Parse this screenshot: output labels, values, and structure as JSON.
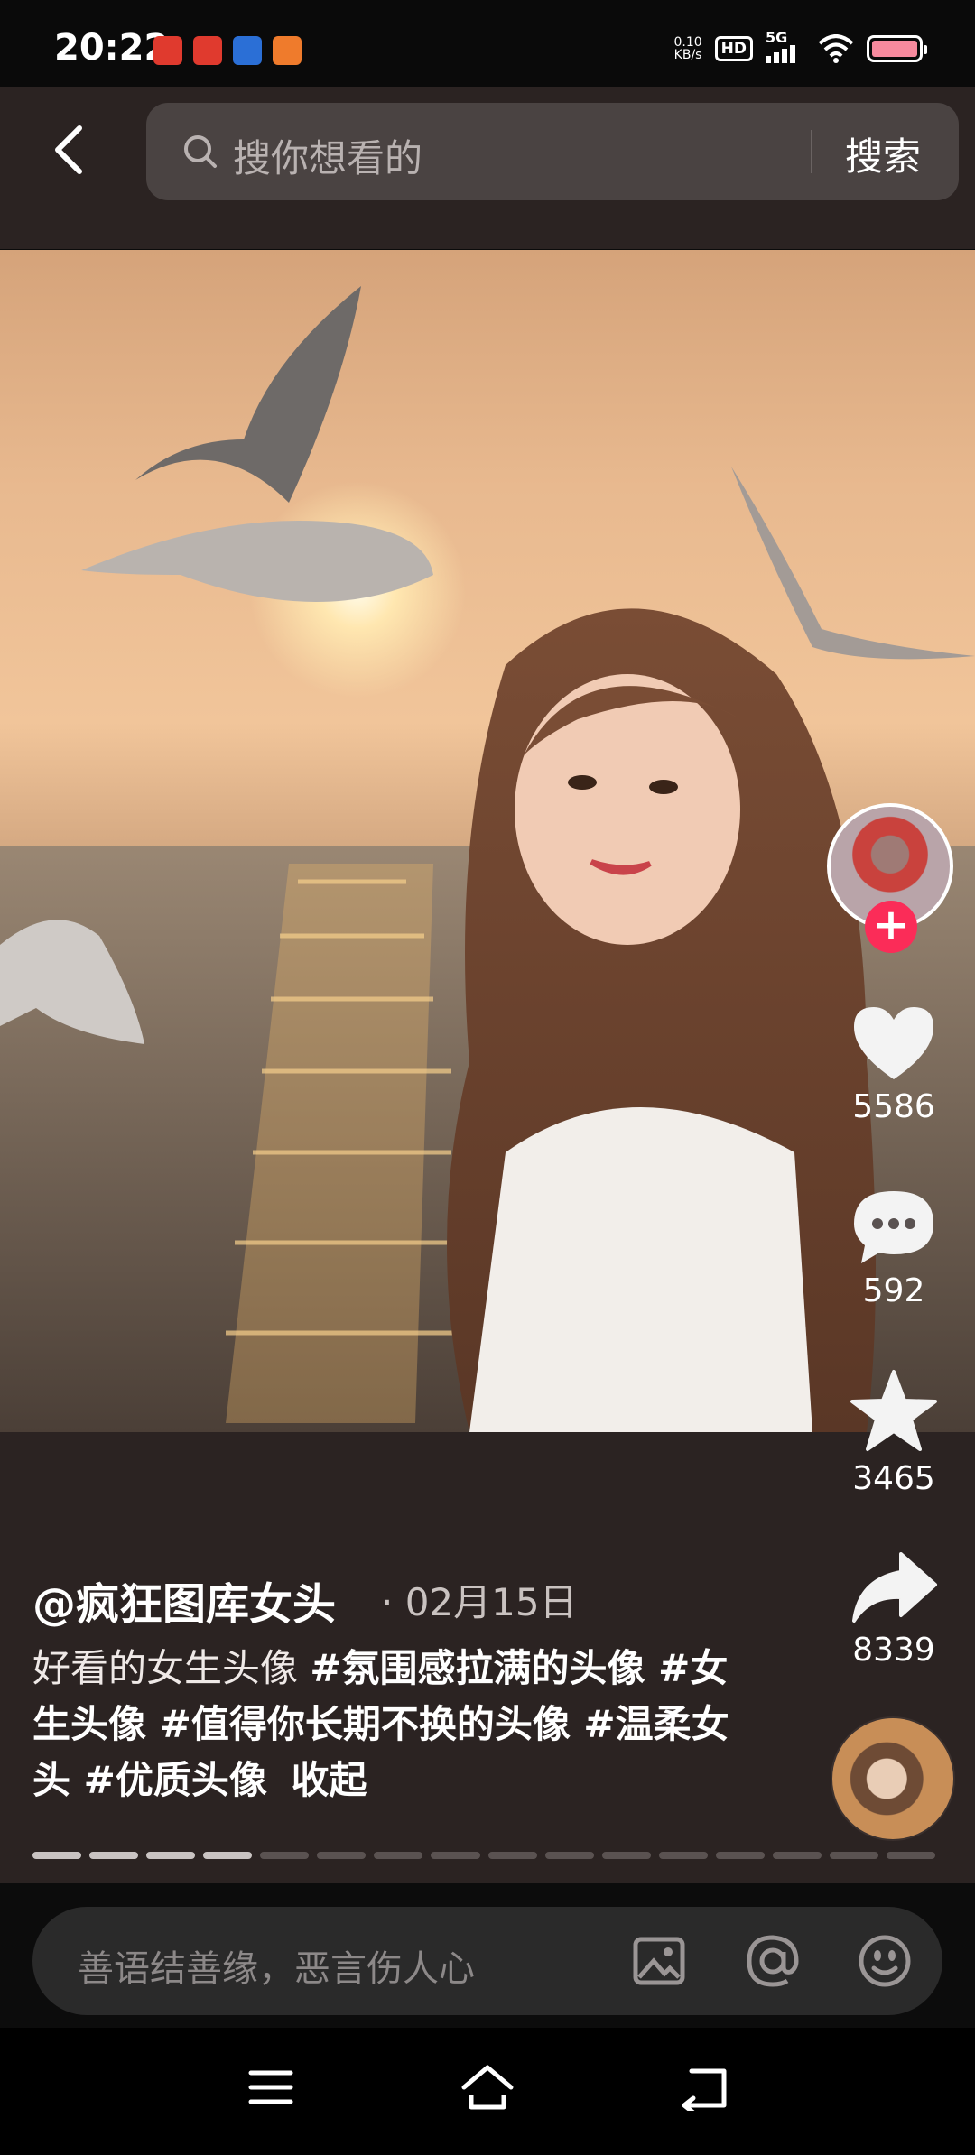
{
  "status": {
    "time": "20:22",
    "net_speed_value": "0.10",
    "net_speed_unit": "KB/s",
    "hd": "HD",
    "signal": "5G"
  },
  "search": {
    "placeholder": "搜你想看的",
    "button_label": "搜索"
  },
  "post": {
    "author": "@疯狂图库女头",
    "date": "02月15日",
    "desc_plain": "好看的女生头像 ",
    "tags": [
      "#氛围感拉满的头像 #女生头像 #值得你长期不换的头像 #温柔女头 #优质头像"
    ],
    "collapse_label": "收起"
  },
  "actions": {
    "likes": "5586",
    "comments": "592",
    "favorites": "3465",
    "shares": "8339"
  },
  "progress": {
    "total_segments": 16,
    "active_segments": 4
  },
  "comment": {
    "placeholder": "善语结善缘，恶言伤人心"
  },
  "colors": {
    "accent": "#fb2c58",
    "panel": "#2b2322"
  }
}
